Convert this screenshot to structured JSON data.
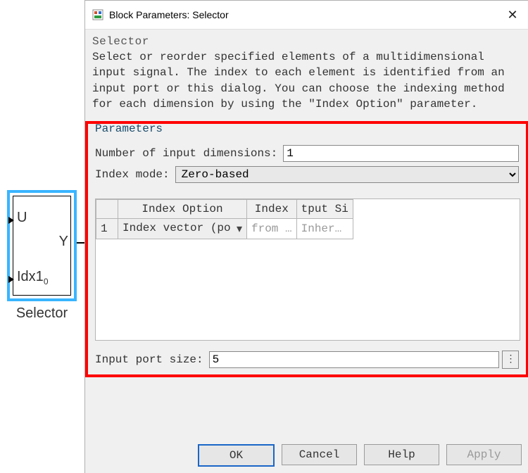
{
  "dialog": {
    "title": "Block Parameters: Selector",
    "section_title": "Selector",
    "description": "Select or reorder specified elements of a multidimensional input signal. The index to each element is identified from an input port or this dialog. You can choose the indexing method for each dimension by using the \"Index Option\" parameter."
  },
  "params": {
    "legend": "Parameters",
    "num_input_dims_label": "Number of input dimensions:",
    "num_input_dims_value": "1",
    "index_mode_label": "Index mode:",
    "index_mode_value": "Zero-based",
    "input_port_size_label": "Input port size:",
    "input_port_size_value": "5"
  },
  "option_table": {
    "headers": {
      "index_option": "Index Option",
      "index": "Index",
      "output_size": "tput Si"
    },
    "rows": [
      {
        "rownum": "1",
        "index_option": "Index vector (po",
        "index": "from …",
        "output_size": "Inher…"
      }
    ]
  },
  "block": {
    "port_u": "U",
    "port_y": "Y",
    "port_idx": "Idx1",
    "port_idx_sub": "0",
    "caption": "Selector"
  },
  "buttons": {
    "ok": "OK",
    "cancel": "Cancel",
    "help": "Help",
    "apply": "Apply",
    "more": "⋮"
  }
}
